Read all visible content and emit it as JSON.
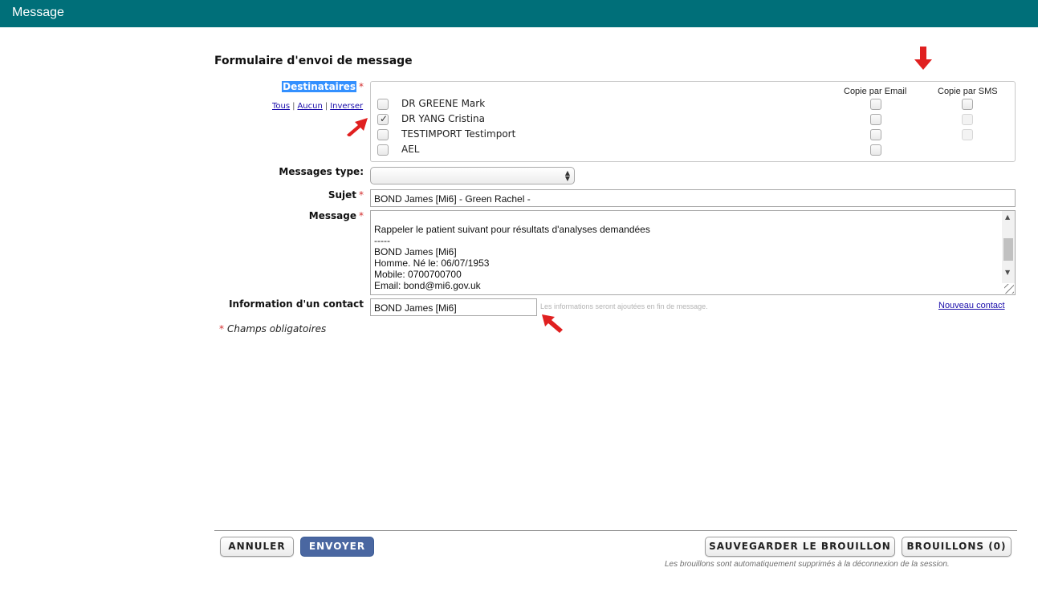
{
  "window": {
    "title": "Message"
  },
  "form": {
    "title": "Formulaire d'envoi de message",
    "required_mark": "*",
    "recipients": {
      "label": "Destinataires",
      "quick_links": {
        "all": "Tous",
        "none": "Aucun",
        "invert": "Inverser",
        "separator": "|"
      },
      "column_email": "Copie par Email",
      "column_sms": "Copie par SMS",
      "items": [
        {
          "name": "DR GREENE Mark",
          "selected": false,
          "email_enabled": true,
          "sms_enabled": true
        },
        {
          "name": "DR YANG Cristina",
          "selected": true,
          "email_enabled": true,
          "sms_enabled": false
        },
        {
          "name": "TESTIMPORT Testimport",
          "selected": false,
          "email_enabled": true,
          "sms_enabled": false
        },
        {
          "name": "AEL",
          "selected": false,
          "email_enabled": true,
          "sms_enabled": null
        }
      ]
    },
    "message_type": {
      "label": "Messages type:",
      "value": ""
    },
    "subject": {
      "label": "Sujet",
      "value": "BOND James [Mi6] - Green Rachel -"
    },
    "message": {
      "label": "Message",
      "value": "Rappeler le patient suivant pour résultats d'analyses demandées\n-----\nBOND James [Mi6]\nHomme. Né le: 06/07/1953\nMobile: 0700700700\nEmail: bond@mi6.gov.uk"
    },
    "contact_info": {
      "label": "Information d'un contact",
      "value": "BOND James [Mi6]",
      "hint": "Les informations seront ajoutées en fin de message.",
      "new_contact_link": "Nouveau contact"
    },
    "required_note": "Champs obligatoires"
  },
  "actions": {
    "cancel": "ANNULER",
    "send": "ENVOYER",
    "save_draft": "SAUVEGARDER LE BROUILLON",
    "drafts": "BROUILLONS (0)",
    "drafts_note": "Les brouillons sont automatiquement supprimés à la déconnexion de la session."
  },
  "colors": {
    "titlebar": "#006f79",
    "primary_button": "#4a67a1",
    "required": "#d32f2f",
    "link": "#1a0dab",
    "annotation_arrow": "#e02020"
  },
  "icons": [
    "checkbox-icon",
    "select-arrows-icon",
    "annotation-arrow-icon"
  ]
}
